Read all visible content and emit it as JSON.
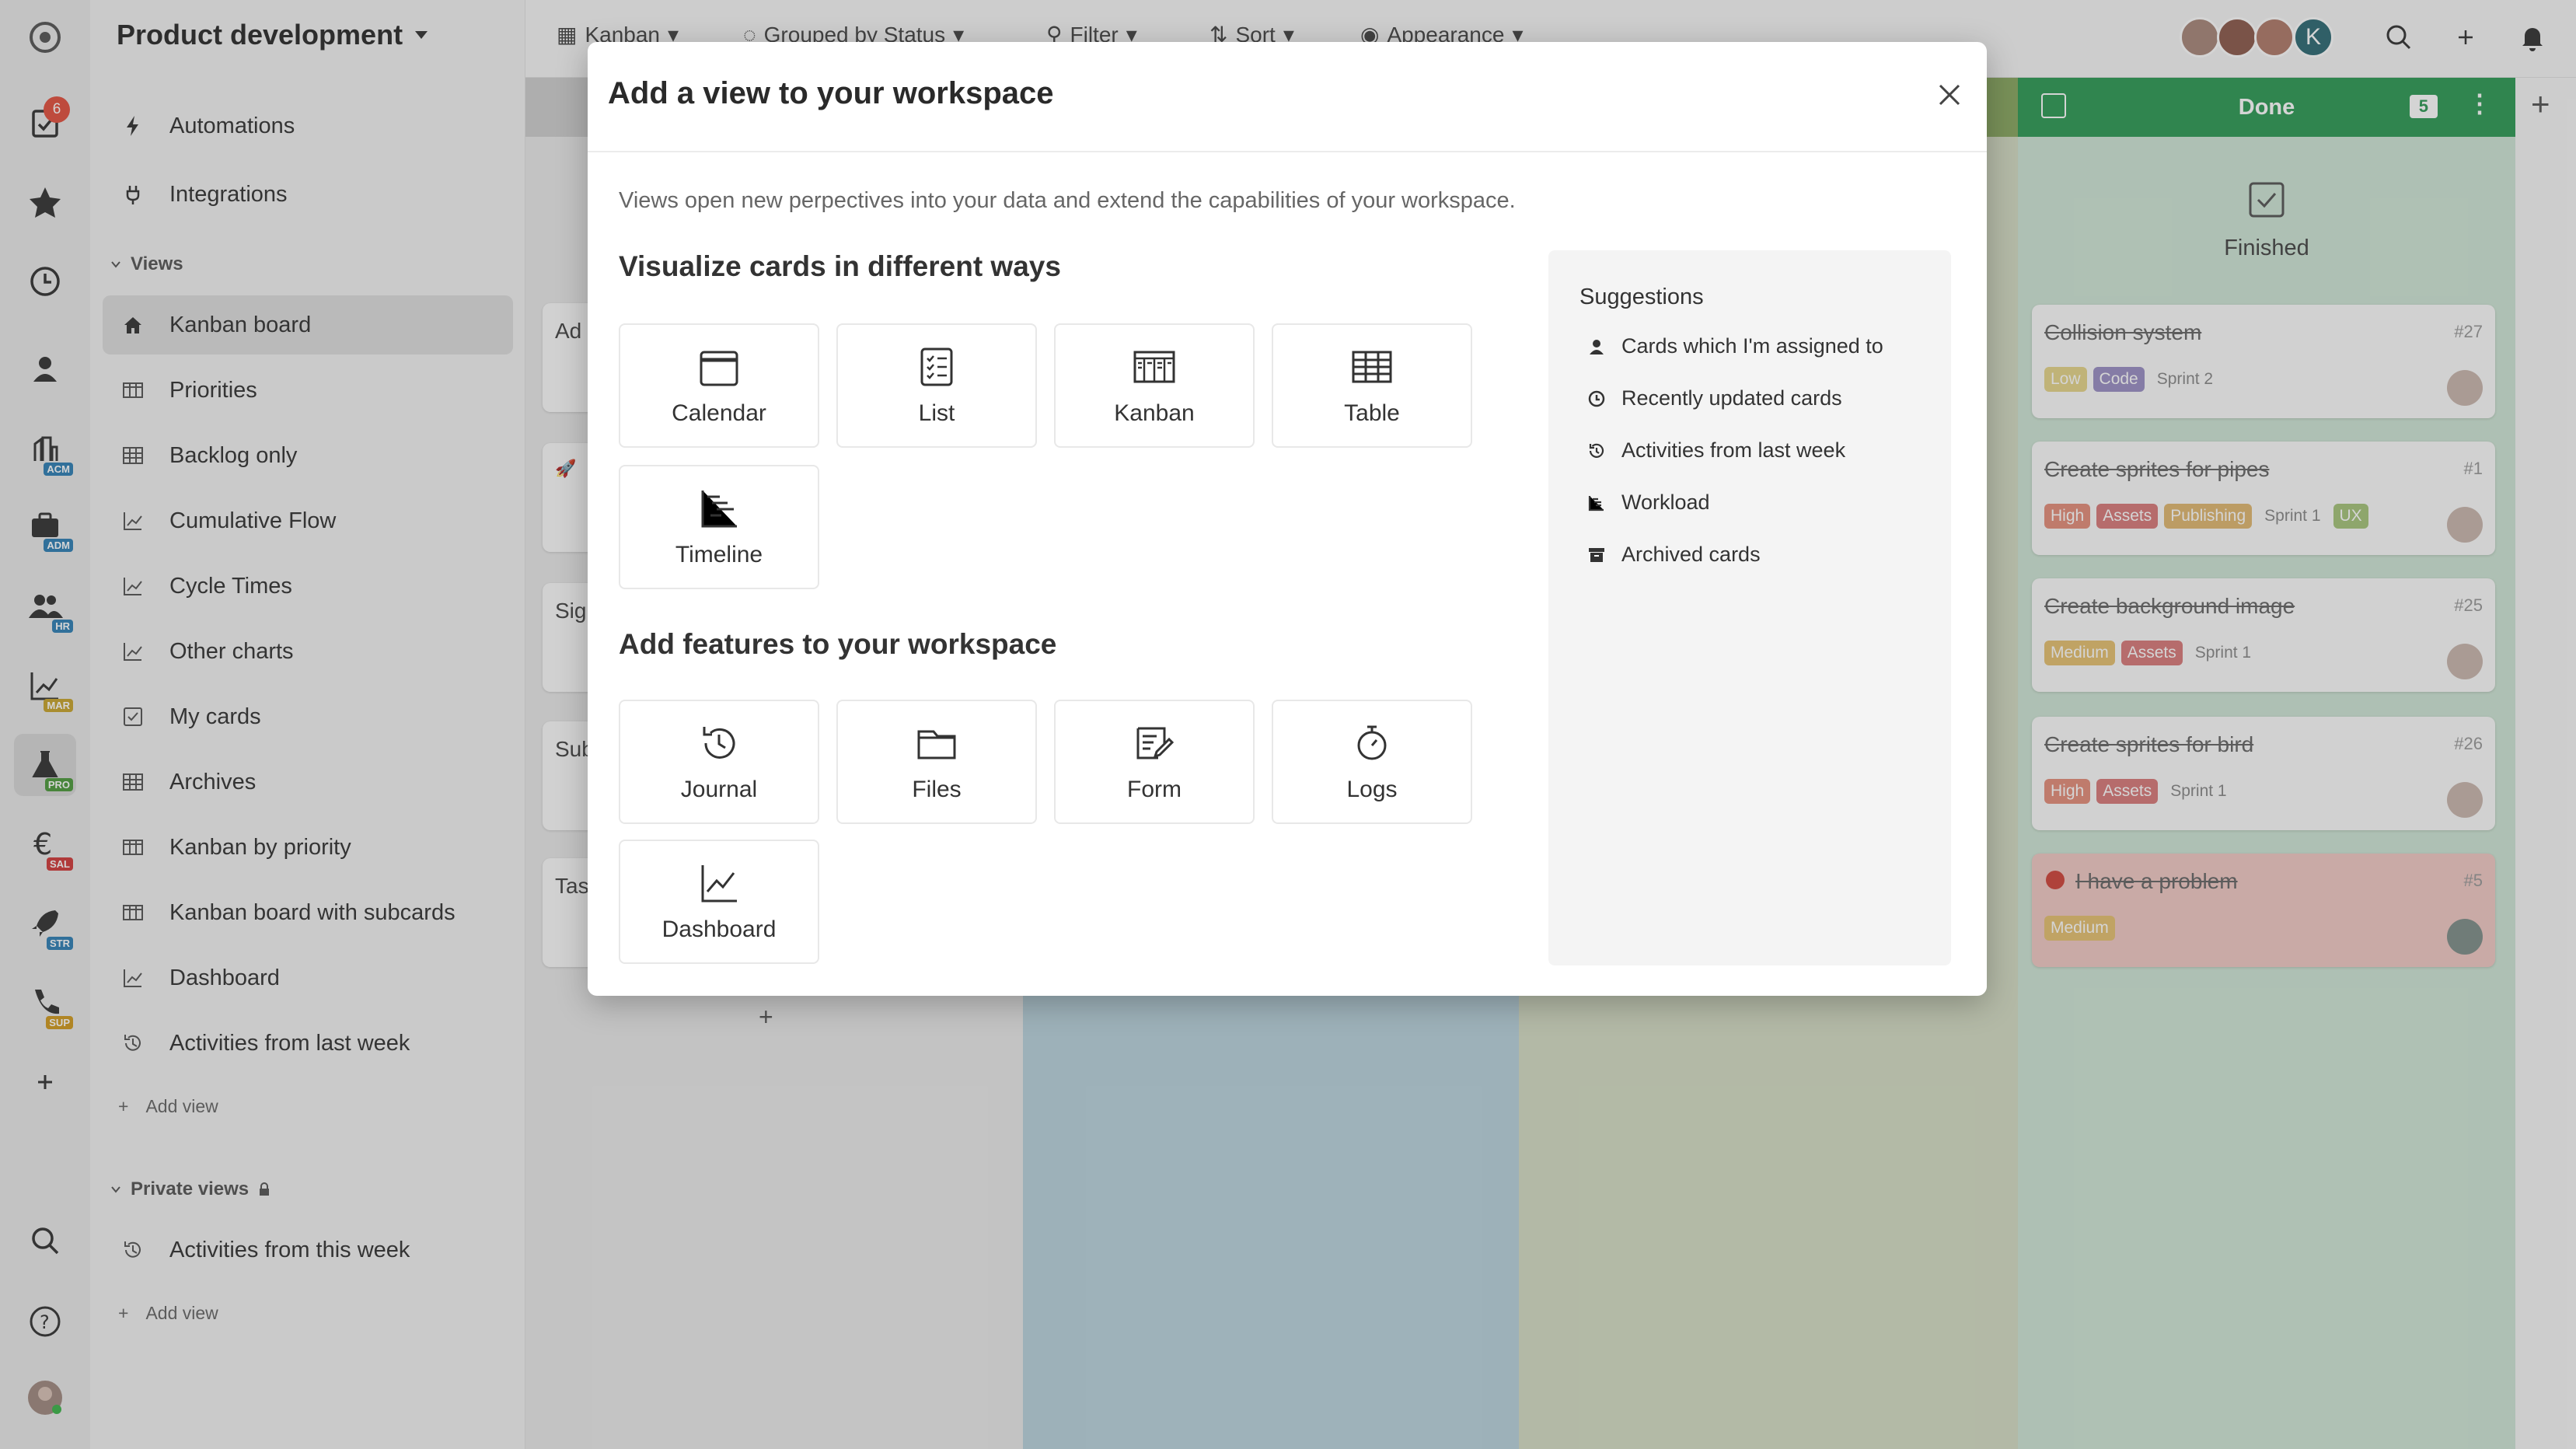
{
  "rail": {
    "task_badge": "6",
    "tags": [
      "ACM",
      "ADM",
      "HR",
      "MAR",
      "PRO",
      "SAL",
      "STR",
      "SUP"
    ],
    "tag_colors": [
      "#2f7fb5",
      "#2f7fb5",
      "#2f7fb5",
      "#c8a42c",
      "#4c9a3c",
      "#d13a3a",
      "#2f7fb5",
      "#d19a1e"
    ]
  },
  "sidebar": {
    "workspace": "Product development",
    "top_items": [
      {
        "label": "Automations",
        "icon": "bolt-icon"
      },
      {
        "label": "Integrations",
        "icon": "plug-icon"
      }
    ],
    "views_header": "Views",
    "views": [
      {
        "label": "Kanban board",
        "icon": "home-icon"
      },
      {
        "label": "Priorities",
        "icon": "kanban-icon"
      },
      {
        "label": "Backlog only",
        "icon": "table-icon"
      },
      {
        "label": "Cumulative Flow",
        "icon": "chart-icon"
      },
      {
        "label": "Cycle Times",
        "icon": "chart-icon"
      },
      {
        "label": "Other charts",
        "icon": "chart-icon"
      },
      {
        "label": "My cards",
        "icon": "checkbox-icon"
      },
      {
        "label": "Archives",
        "icon": "table-icon"
      },
      {
        "label": "Kanban by priority",
        "icon": "kanban-icon"
      },
      {
        "label": "Kanban board with subcards",
        "icon": "kanban-icon"
      },
      {
        "label": "Dashboard",
        "icon": "chart-icon"
      },
      {
        "label": "Activities from last week",
        "icon": "history-icon"
      }
    ],
    "add_view": "Add view",
    "private_header": "Private views",
    "private_views": [
      {
        "label": "Activities from this week",
        "icon": "history-icon"
      }
    ],
    "add_view_private": "Add view"
  },
  "topbar": {
    "items": [
      "Kanban",
      "Grouped by Status",
      "Filter",
      "Sort",
      "Appearance"
    ],
    "avatar_initial": "K"
  },
  "board": {
    "done_title": "Done",
    "done_count": "5",
    "finished_label": "Finished",
    "done_cards": [
      {
        "title": "Collision system",
        "num": "#27",
        "tags": [
          {
            "t": "Low",
            "c": "#e6d58a"
          },
          {
            "t": "Code",
            "c": "#9a8fc4"
          },
          {
            "t": "Sprint 2",
            "c": ""
          }
        ]
      },
      {
        "title": "Create sprites for pipes",
        "num": "#1",
        "tags": [
          {
            "t": "High",
            "c": "#e48d7a"
          },
          {
            "t": "Assets",
            "c": "#d97a7a"
          },
          {
            "t": "Publishing",
            "c": "#e0b870"
          },
          {
            "t": "Sprint 1",
            "c": ""
          },
          {
            "t": "UX",
            "c": "#a6c47a"
          }
        ]
      },
      {
        "title": "Create background image",
        "num": "#25",
        "tags": [
          {
            "t": "Medium",
            "c": "#e6c070"
          },
          {
            "t": "Assets",
            "c": "#d97a7a"
          },
          {
            "t": "Sprint 1",
            "c": ""
          }
        ]
      },
      {
        "title": "Create sprites for bird",
        "num": "#26",
        "tags": [
          {
            "t": "High",
            "c": "#e48d7a"
          },
          {
            "t": "Assets",
            "c": "#d97a7a"
          },
          {
            "t": "Sprint 1",
            "c": ""
          }
        ]
      },
      {
        "title": "I have a problem",
        "num": "#5",
        "tags": [
          {
            "t": "Medium",
            "c": "#e6c070"
          }
        ]
      }
    ],
    "partial_cards": [
      "Ad",
      "Sig",
      "Sub",
      "Tas"
    ]
  },
  "dialog": {
    "title": "Add a view to your workspace",
    "description": "Views open new perpectives into your data and extend the capabilities of your workspace.",
    "visualize_heading": "Visualize cards in different ways",
    "visualize_tiles": [
      {
        "label": "Calendar",
        "icon": "calendar-icon"
      },
      {
        "label": "List",
        "icon": "list-icon"
      },
      {
        "label": "Kanban",
        "icon": "kanban-icon"
      },
      {
        "label": "Table",
        "icon": "table-icon"
      },
      {
        "label": "Timeline",
        "icon": "timeline-icon"
      }
    ],
    "features_heading": "Add features to your workspace",
    "feature_tiles": [
      {
        "label": "Journal",
        "icon": "history-icon"
      },
      {
        "label": "Files",
        "icon": "folder-icon"
      },
      {
        "label": "Form",
        "icon": "form-icon"
      },
      {
        "label": "Logs",
        "icon": "stopwatch-icon"
      },
      {
        "label": "Dashboard",
        "icon": "chart-icon"
      }
    ],
    "suggestions_title": "Suggestions",
    "suggestions": [
      {
        "label": "Cards which I'm assigned to",
        "icon": "person-icon"
      },
      {
        "label": "Recently updated cards",
        "icon": "clock-icon"
      },
      {
        "label": "Activities from last week",
        "icon": "history-icon"
      },
      {
        "label": "Workload",
        "icon": "workload-icon"
      },
      {
        "label": "Archived cards",
        "icon": "archive-icon"
      }
    ]
  }
}
